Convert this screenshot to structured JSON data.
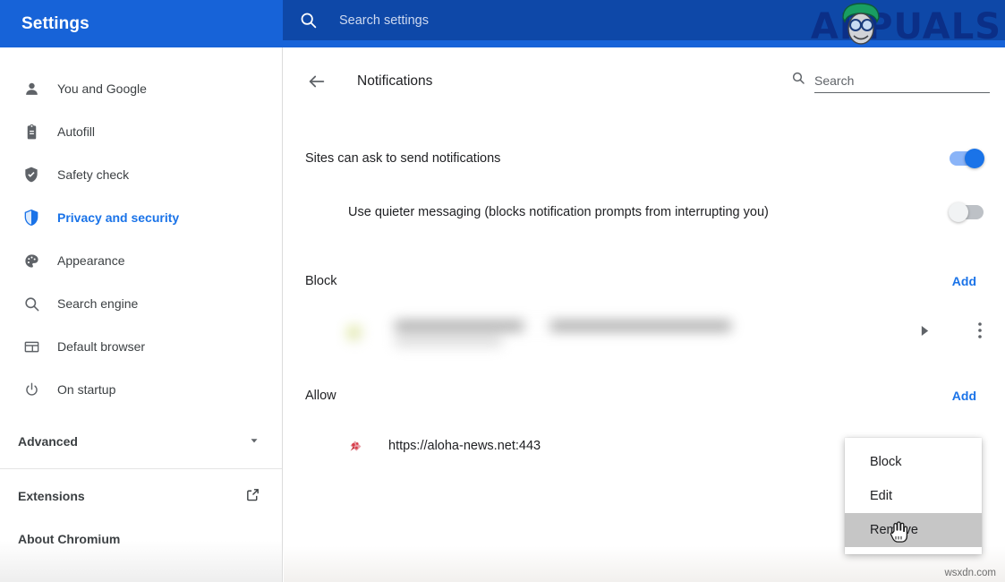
{
  "app": {
    "title": "Settings",
    "watermark_logo": "APPUALS",
    "watermark_footer": "wsxdn.com"
  },
  "topbar": {
    "search_placeholder": "Search settings",
    "search_value": "",
    "search_icon": "search-icon"
  },
  "sidebar": {
    "items": [
      {
        "label": "You and Google",
        "icon": "person-icon",
        "active": false
      },
      {
        "label": "Autofill",
        "icon": "clipboard-icon",
        "active": false
      },
      {
        "label": "Safety check",
        "icon": "shield-check-icon",
        "active": false
      },
      {
        "label": "Privacy and security",
        "icon": "shield-icon",
        "active": true
      },
      {
        "label": "Appearance",
        "icon": "palette-icon",
        "active": false
      },
      {
        "label": "Search engine",
        "icon": "search-icon",
        "active": false
      },
      {
        "label": "Default browser",
        "icon": "browser-window-icon",
        "active": false
      },
      {
        "label": "On startup",
        "icon": "power-icon",
        "active": false
      }
    ],
    "advanced": {
      "label": "Advanced",
      "icon": "chevron-down-icon"
    },
    "bottom": [
      {
        "label": "Extensions",
        "icon": "external-link-icon"
      },
      {
        "label": "About Chromium",
        "icon": ""
      }
    ]
  },
  "main": {
    "back_icon": "back-arrow-icon",
    "page_title": "Notifications",
    "search": {
      "placeholder": "Search",
      "value": "",
      "icon": "search-icon"
    },
    "settings": [
      {
        "label": "Sites can ask to send notifications",
        "state": "on",
        "indented": false
      },
      {
        "label": "Use quieter messaging (blocks notification prompts from interrupting you)",
        "state": "off",
        "indented": true
      }
    ],
    "sections": [
      {
        "title": "Block",
        "add_label": "Add",
        "entries": [
          {
            "url": "",
            "redacted": true,
            "expand_icon": "triangle-right-icon",
            "kebab_icon": "more-vertical-icon"
          }
        ]
      },
      {
        "title": "Allow",
        "add_label": "Add",
        "entries": [
          {
            "url": "https://aloha-news.net:443",
            "redacted": false,
            "favicon": "site-favicon"
          }
        ]
      }
    ]
  },
  "context_menu": {
    "items": [
      {
        "label": "Block",
        "hovered": false
      },
      {
        "label": "Edit",
        "hovered": false
      },
      {
        "label": "Remove",
        "hovered": true
      }
    ]
  },
  "colors": {
    "brand_blue": "#1763d8",
    "search_box_blue": "#0e48a8",
    "accent_link": "#1a73e8",
    "toggle_on_track": "#8ab4f8",
    "toggle_on_knob": "#1a73e8",
    "toggle_off_track": "#bdc1c6",
    "text_primary": "#202124",
    "text_secondary": "#3c4043"
  }
}
